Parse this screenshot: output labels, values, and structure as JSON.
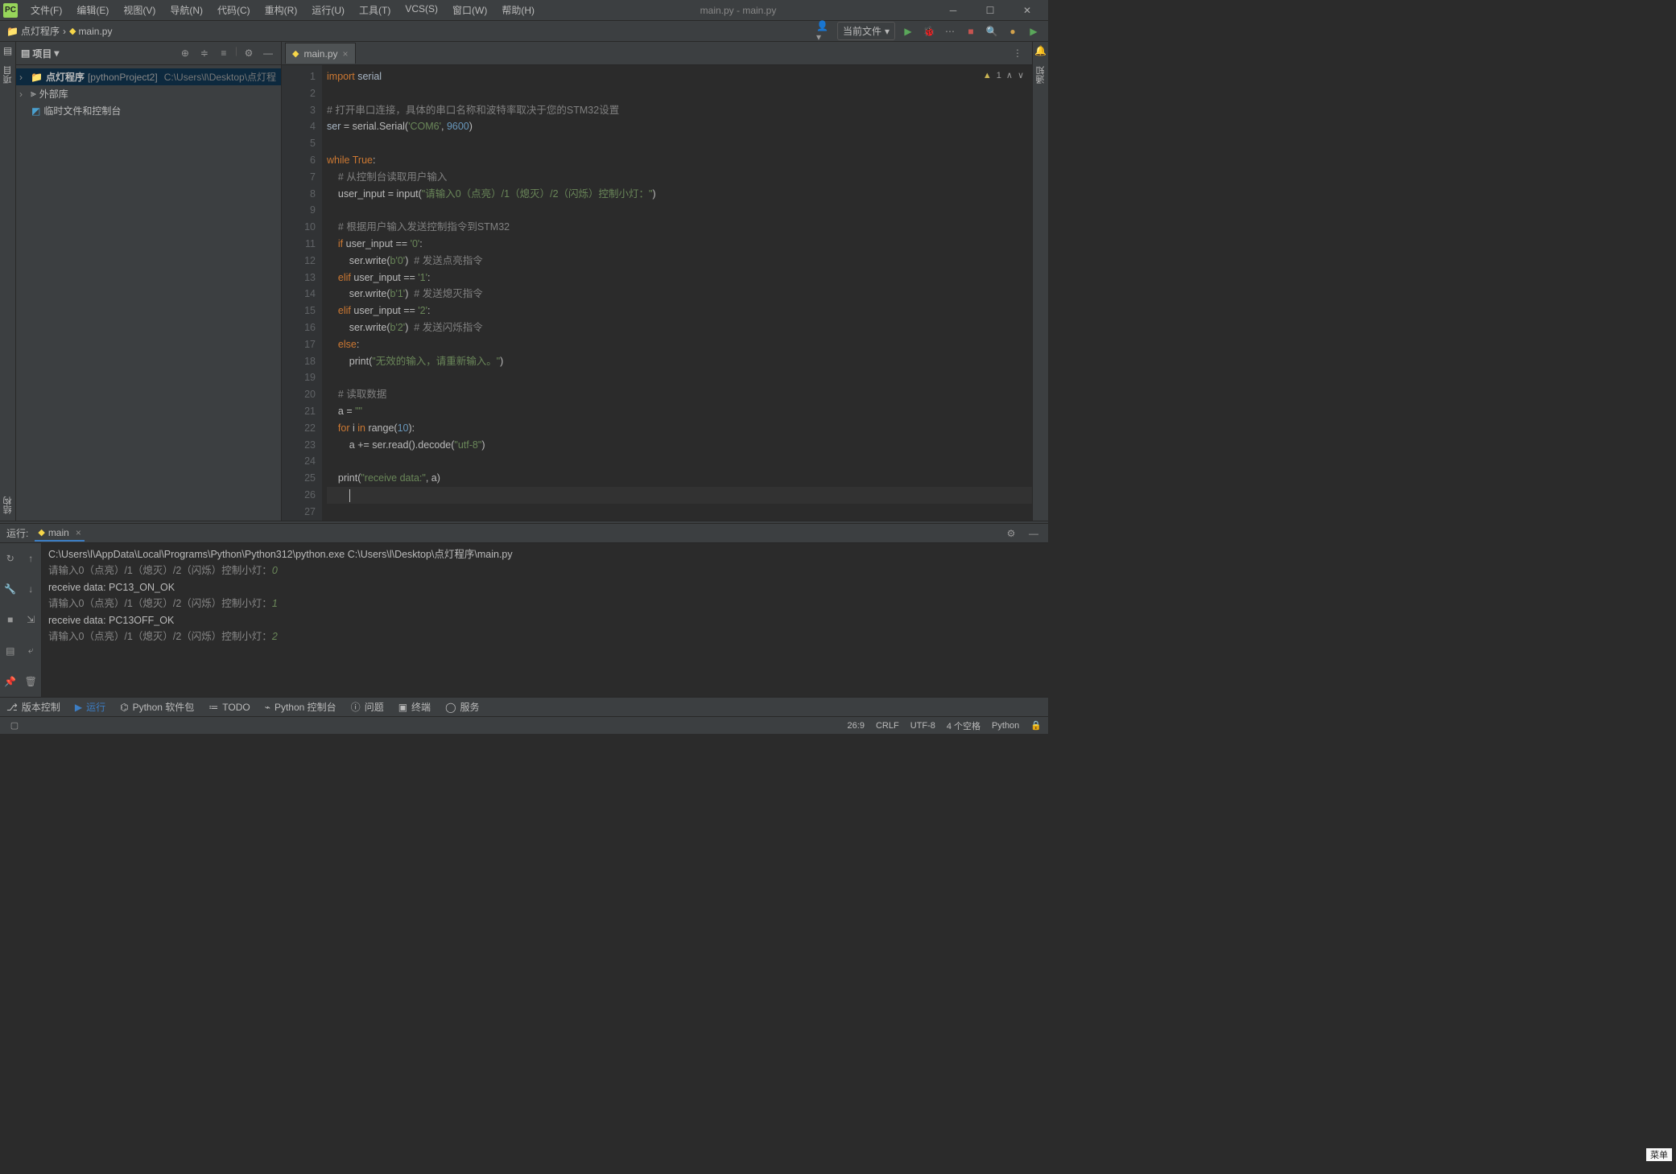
{
  "menu": {
    "file": "文件(F)",
    "edit": "编辑(E)",
    "view": "视图(V)",
    "nav": "导航(N)",
    "code": "代码(C)",
    "refactor": "重构(R)",
    "run": "运行(U)",
    "tools": "工具(T)",
    "vcs": "VCS(S)",
    "window": "窗口(W)",
    "help": "帮助(H)"
  },
  "title": "main.py - main.py",
  "breadcrumb": {
    "proj": "点灯程序",
    "file": "main.py"
  },
  "runconfig": {
    "current": "当前文件"
  },
  "sidebar": {
    "head": "项目",
    "root": "点灯程序",
    "rootMod": "[pythonProject2]",
    "rootPath": "C:\\Users\\l\\Desktop\\点灯程",
    "extlib": "外部库",
    "scratch": "临时文件和控制台"
  },
  "leftRail": {
    "proj": "项目",
    "struct": "结构"
  },
  "rightRail": {
    "notif": "通知",
    "db": "数据库"
  },
  "tab": {
    "name": "main.py"
  },
  "warnBadge": {
    "count": "1"
  },
  "gutterLines": 28,
  "code": [
    {
      "t": "<kwd>import</kwd> <ident>serial</ident>"
    },
    {
      "t": ""
    },
    {
      "t": "<cmt># 打开串口连接，具体的串口名称和波特率取决于您的STM32设置</cmt>"
    },
    {
      "t": "<ident>ser</ident> = serial.Serial(<str>'COM6'</str>, <num>9600</num>)"
    },
    {
      "t": ""
    },
    {
      "t": "<kwd>while</kwd> <kwd>True</kwd>:"
    },
    {
      "t": "    <cmt># 从控制台读取用户输入</cmt>"
    },
    {
      "t": "    user_input = input(<str>\"请输入0（点亮）/1（熄灭）/2（闪烁）控制小灯：\"</str>)"
    },
    {
      "t": ""
    },
    {
      "t": "    <cmt># 根据用户输入发送控制指令到STM32</cmt>"
    },
    {
      "t": "    <kwd>if</kwd> user_input == <str>'0'</str>:"
    },
    {
      "t": "        ser.write(<str>b'0'</str>)  <cmt># 发送点亮指令</cmt>"
    },
    {
      "t": "    <kwd>elif</kwd> user_input == <str>'1'</str>:"
    },
    {
      "t": "        ser.write(<str>b'1'</str>)  <cmt># 发送熄灭指令</cmt>"
    },
    {
      "t": "    <kwd>elif</kwd> user_input == <str>'2'</str>:"
    },
    {
      "t": "        ser.write(<str>b'2'</str>)  <cmt># 发送闪烁指令</cmt>"
    },
    {
      "t": "    <kwd>else</kwd>:"
    },
    {
      "t": "        print(<str>\"无效的输入，请重新输入。\"</str>)"
    },
    {
      "t": ""
    },
    {
      "t": "    <cmt># 读取数据</cmt>"
    },
    {
      "t": "    a = <str>\"\"</str>"
    },
    {
      "t": "    <kwd>for</kwd> i <kwd>in</kwd> range(<num>10</num>):"
    },
    {
      "t": "        a += ser.read().decode(<str>\"utf-8\"</str>)"
    },
    {
      "t": ""
    },
    {
      "t": "    print(<str>\"receive data:\"</str>, a)"
    },
    {
      "t": "        <caret></caret>",
      "hl": true
    },
    {
      "t": ""
    }
  ],
  "run": {
    "title": "运行:",
    "tab": "main",
    "lines": [
      {
        "cls": "out",
        "t": "C:\\Users\\l\\AppData\\Local\\Programs\\Python\\Python312\\python.exe C:\\Users\\l\\Desktop\\点灯程序\\main.py"
      },
      {
        "cls": "prompt",
        "t": "请输入0（点亮）/1（熄灭）/2（闪烁）控制小灯：",
        "suffix": "0",
        "sufcls": "in-green"
      },
      {
        "cls": "out",
        "t": "receive data: PC13_ON_OK"
      },
      {
        "cls": "prompt",
        "t": "请输入0（点亮）/1（熄灭）/2（闪烁）控制小灯：",
        "suffix": "1",
        "sufcls": "in-green"
      },
      {
        "cls": "out",
        "t": "receive data: PC13OFF_OK"
      },
      {
        "cls": "prompt",
        "t": "请输入0（点亮）/1（熄灭）/2（闪烁）控制小灯：",
        "suffix": "2",
        "sufcls": "in-green"
      }
    ]
  },
  "bottomTools": {
    "vcs": "版本控制",
    "run": "运行",
    "pkgs": "Python 软件包",
    "todo": "TODO",
    "pycon": "Python 控制台",
    "problems": "问题",
    "term": "终端",
    "services": "服务"
  },
  "status": {
    "pos": "26:9",
    "le": "CRLF",
    "enc": "UTF-8",
    "indent": "4 个空格",
    "interp": "Python"
  },
  "menuBadge": "菜单"
}
